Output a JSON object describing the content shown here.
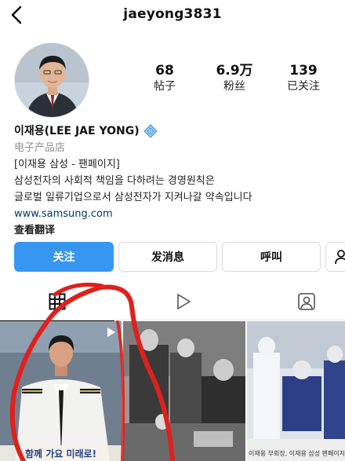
{
  "header": {
    "username": "jaeyong3831"
  },
  "stats": [
    {
      "value": "68",
      "label": "帖子"
    },
    {
      "value": "6.9万",
      "label": "粉丝"
    },
    {
      "value": "139",
      "label": "已关注"
    }
  ],
  "bio": {
    "name": "이재용(LEE JAE YONG)",
    "category": "电子产品店",
    "lines": [
      "[이재용 삼성 - 팬페이지]",
      "삼성전자의 사회적 책임을 다하려는 경영원칙은",
      "글로벌 일류기업으로서 삼성전자가 지켜나갈 약속입니다"
    ],
    "link": "www.samsung.com",
    "translate": "查看翻译"
  },
  "buttons": {
    "follow": "关注",
    "message": "发消息",
    "call": "呼叫"
  },
  "tiles": [
    {
      "caption": "함께 가요 미래로!"
    },
    {
      "caption": ""
    },
    {
      "caption": "이재용 부회장, 이재용 삼성 팬페이지"
    }
  ],
  "colors": {
    "accent": "#3797f0",
    "annotation": "#e0201c"
  },
  "icons": {
    "back": "chevron-left-icon",
    "verified": "verified-badge-icon",
    "grid": "grid-icon",
    "reels": "reels-icon",
    "tagged": "tagged-icon",
    "add_user": "add-user-icon"
  }
}
